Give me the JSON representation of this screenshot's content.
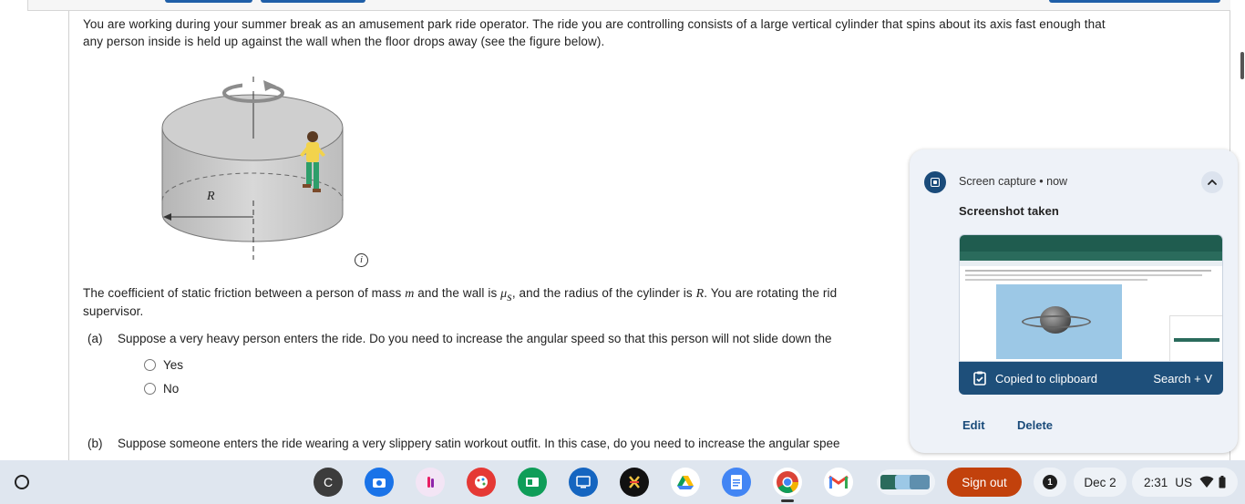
{
  "question": {
    "intro_line1": "You are working during your summer break as an amusement park ride operator. The ride you are controlling consists of a large vertical cylinder that spins about its axis fast enough that",
    "intro_line2": "any person inside is held up against the wall when the floor drops away (see the figure below).",
    "figure_label_r": "R",
    "info_icon": "i",
    "friction_part1": "The coefficient of static friction between a person of mass ",
    "mass_symbol": "m",
    "friction_part2": " and the wall is ",
    "mu_symbol": "μ",
    "mu_sub": "s",
    "friction_part3": ", and the radius of the cylinder is ",
    "radius_symbol": "R",
    "friction_part4": ". You are rotating the rid",
    "friction_line2": "supervisor.",
    "part_a_tag": "(a)",
    "part_a_text": "Suppose a very heavy person enters the ride. Do you need to increase the angular speed so that this person will not slide down the",
    "option_yes": "Yes",
    "option_no": "No",
    "part_b_tag": "(b)",
    "part_b_text": "Suppose someone enters the ride wearing a very slippery satin workout outfit. In this case, do you need to increase the angular spee"
  },
  "notification": {
    "source": "Screen capture",
    "separator": "•",
    "time": "now",
    "title": "Screenshot taken",
    "clipboard_label": "Copied to clipboard",
    "clipboard_shortcut": "Search + V",
    "edit_label": "Edit",
    "delete_label": "Delete",
    "app_icon": "screen-capture-icon"
  },
  "shelf": {
    "apps": [
      {
        "name": "account-c-icon",
        "letter": "C",
        "color": "#3c3c3c"
      },
      {
        "name": "camera-app-icon",
        "color": "#1a73e8"
      },
      {
        "name": "hand-app-icon",
        "color": "#f3e5f5"
      },
      {
        "name": "palette-app-icon",
        "color": "#e53935"
      },
      {
        "name": "classroom-app-icon",
        "color": "#0f9d58"
      },
      {
        "name": "cast-app-icon",
        "color": "#1565c0"
      },
      {
        "name": "kami-app-icon",
        "color": "#111111"
      },
      {
        "name": "drive-app-icon",
        "color": "#ffffff"
      },
      {
        "name": "docs-app-icon",
        "color": "#4285f4"
      },
      {
        "name": "chrome-app-icon",
        "color": "#ffffff"
      },
      {
        "name": "gmail-app-icon",
        "color": "#ffffff"
      }
    ],
    "signout_label": "Sign out",
    "notification_count": "1",
    "date": "Dec 2",
    "time": "2:31",
    "locale": "US"
  },
  "colors": {
    "brand_blue": "#1e4f7a",
    "signout": "#c2410c"
  }
}
